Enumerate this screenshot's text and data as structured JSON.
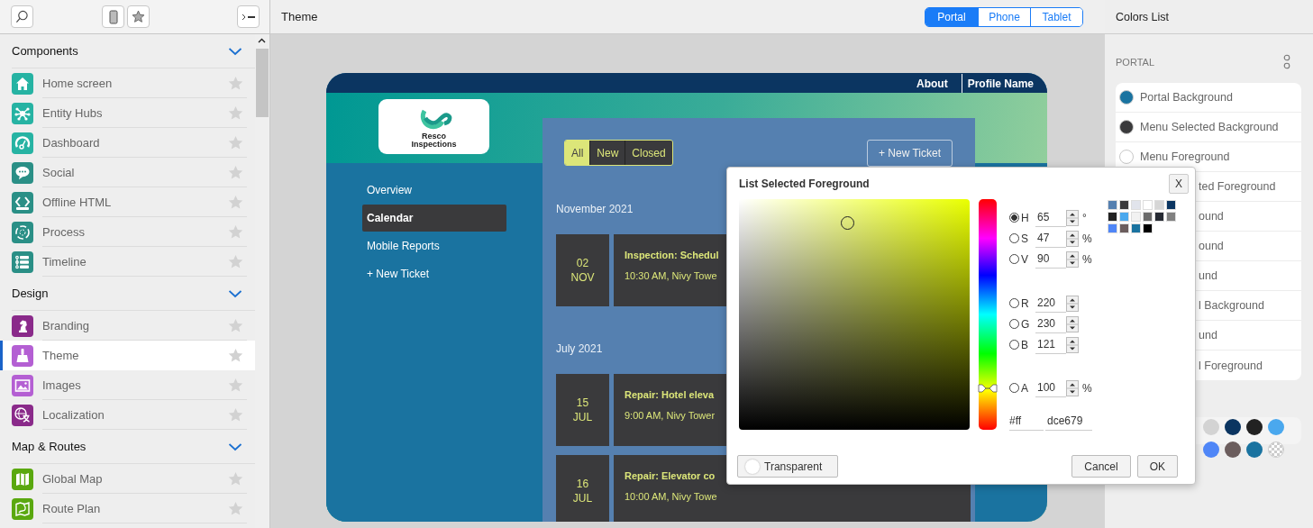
{
  "sidebar": {
    "sections": [
      {
        "title": "Components",
        "expanded": true,
        "items": [
          {
            "label": "Home screen",
            "color": "#26b3a3",
            "selected": false
          },
          {
            "label": "Entity Hubs",
            "color": "#26b3a3",
            "selected": false
          },
          {
            "label": "Dashboard",
            "color": "#26b3a3",
            "selected": false
          },
          {
            "label": "Social",
            "color": "#2a8f86",
            "selected": false
          },
          {
            "label": "Offline HTML",
            "color": "#2a8f86",
            "selected": false
          },
          {
            "label": "Process",
            "color": "#2a8f86",
            "selected": false
          },
          {
            "label": "Timeline",
            "color": "#2a8f86",
            "selected": false
          }
        ]
      },
      {
        "title": "Design",
        "expanded": true,
        "items": [
          {
            "label": "Branding",
            "color": "#8a2a8a",
            "selected": false
          },
          {
            "label": "Theme",
            "color": "#b45fd3",
            "selected": true
          },
          {
            "label": "Images",
            "color": "#b45fd3",
            "selected": false
          },
          {
            "label": "Localization",
            "color": "#8a2a8a",
            "selected": false
          }
        ]
      },
      {
        "title": "Map & Routes",
        "expanded": true,
        "items": [
          {
            "label": "Global Map",
            "color": "#5aa80f",
            "selected": false
          },
          {
            "label": "Route Plan",
            "color": "#5aa80f",
            "selected": false
          }
        ]
      }
    ]
  },
  "header": {
    "title": "Theme",
    "tabs": [
      {
        "label": "Portal",
        "selected": true
      },
      {
        "label": "Phone",
        "selected": false
      },
      {
        "label": "Tablet",
        "selected": false
      }
    ]
  },
  "portal": {
    "top_links": [
      "About",
      "Profile Name"
    ],
    "logo_text": "Resco Inspections",
    "nav": [
      {
        "label": "Overview",
        "selected": false
      },
      {
        "label": "Calendar",
        "selected": true
      },
      {
        "label": "Mobile Reports",
        "selected": false
      },
      {
        "label": "+ New Ticket",
        "selected": false
      }
    ],
    "filters": [
      {
        "label": "All",
        "selected": true
      },
      {
        "label": "New",
        "selected": false
      },
      {
        "label": "Closed",
        "selected": false
      }
    ],
    "new_ticket": "+ New Ticket",
    "groups": [
      {
        "month": "November 2021",
        "events": [
          {
            "day": "02",
            "month": "NOV",
            "title": "Inspection: Schedul",
            "subtitle": "10:30 AM, Nivy Towe"
          }
        ]
      },
      {
        "month": "July 2021",
        "events": [
          {
            "day": "15",
            "month": "JUL",
            "title": "Repair: Hotel eleva",
            "subtitle": "9:00 AM, Nivy Tower"
          },
          {
            "day": "16",
            "month": "JUL",
            "title": "Repair: Elevator co",
            "subtitle": "10:00 AM, Nivy Towe"
          }
        ]
      }
    ]
  },
  "color_dialog": {
    "title": "List Selected Foreground",
    "close": "X",
    "hue": {
      "level": 0.18
    },
    "channel_groups": [
      [
        {
          "label": "H",
          "value": "65",
          "unit": "°",
          "selected": true
        },
        {
          "label": "S",
          "value": "47",
          "unit": "%",
          "selected": false
        },
        {
          "label": "V",
          "value": "90",
          "unit": "%",
          "selected": false
        }
      ],
      [
        {
          "label": "R",
          "value": "220",
          "selected": false
        },
        {
          "label": "G",
          "value": "230",
          "selected": false
        },
        {
          "label": "B",
          "value": "121",
          "selected": false
        }
      ],
      [
        {
          "label": "A",
          "value": "100",
          "unit": "%",
          "selected": false
        }
      ]
    ],
    "alpha_hex": "#ff",
    "hex": "dce679",
    "swatches": [
      {
        "color": "#5580b0"
      },
      {
        "color": "#3a3a3c"
      },
      {
        "color": "#e1e4ec"
      },
      {
        "color": "#ffffff"
      },
      {
        "color": "#d6d6d6"
      },
      {
        "color": "#0b3561"
      },
      {
        "color": "#222222"
      },
      {
        "color": "#4aa8ee"
      },
      {
        "color": "#f2f2f2"
      },
      {
        "color": "#6d6d6d"
      },
      {
        "color": "#262a33"
      },
      {
        "color": "#808080"
      },
      {
        "color": "#4f86f7"
      },
      {
        "color": "#6b5d5d"
      },
      {
        "color": "#1a73a0"
      },
      {
        "color": "#000000"
      }
    ],
    "transparent": {
      "label": "Transparent",
      "on": false
    },
    "buttons": [
      "Cancel",
      "OK"
    ]
  },
  "colors_list": {
    "title": "Colors List",
    "section": "PORTAL",
    "items": [
      {
        "label": "Portal Background",
        "color": "#1a73a0"
      },
      {
        "label": "Menu Selected Background",
        "color": "#3a3a3c"
      },
      {
        "label": "Menu Foreground",
        "color": "#ffffff"
      },
      {
        "label": "ted Foreground"
      },
      {
        "label": "ound"
      },
      {
        "label": "ound"
      },
      {
        "label": "und"
      },
      {
        "label": "l Background"
      },
      {
        "label": "und"
      },
      {
        "label": "l Foreground"
      }
    ],
    "swatch_rows": [
      [
        {
          "color": "#d3d3d3"
        },
        {
          "color": "#0b3561"
        },
        {
          "color": "#222222"
        },
        {
          "color": "#4aa8ee"
        }
      ],
      [
        {
          "color": "#4f86f7"
        },
        {
          "color": "#6b5d5d"
        },
        {
          "color": "#1a73a0"
        },
        {
          "kind": "transparent"
        }
      ]
    ]
  }
}
